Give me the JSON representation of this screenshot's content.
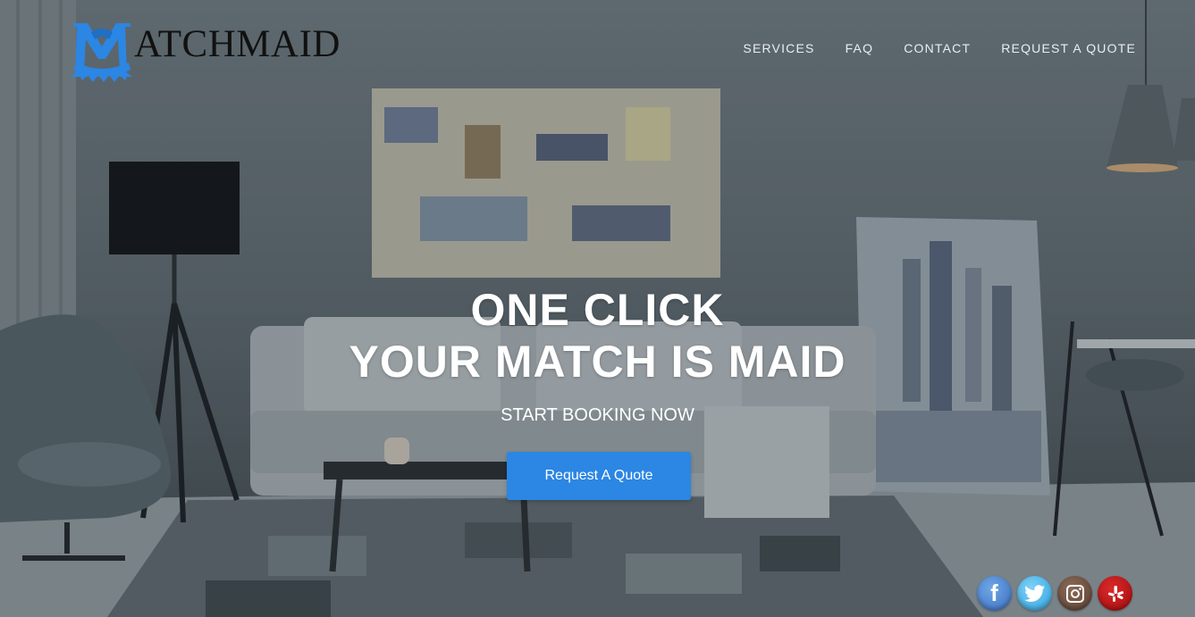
{
  "brand": {
    "logo_text": "ATCHMAID",
    "logo_letter": "M",
    "brand_color": "#2b86e4"
  },
  "nav": {
    "items": [
      "SERVICES",
      "FAQ",
      "CONTACT",
      "REQUEST A QUOTE"
    ]
  },
  "hero": {
    "line1": "ONE CLICK",
    "line2": "YOUR MATCH IS MAID",
    "subtitle": "START BOOKING NOW",
    "cta_label": "Request A Quote"
  },
  "social": {
    "facebook": "f"
  }
}
